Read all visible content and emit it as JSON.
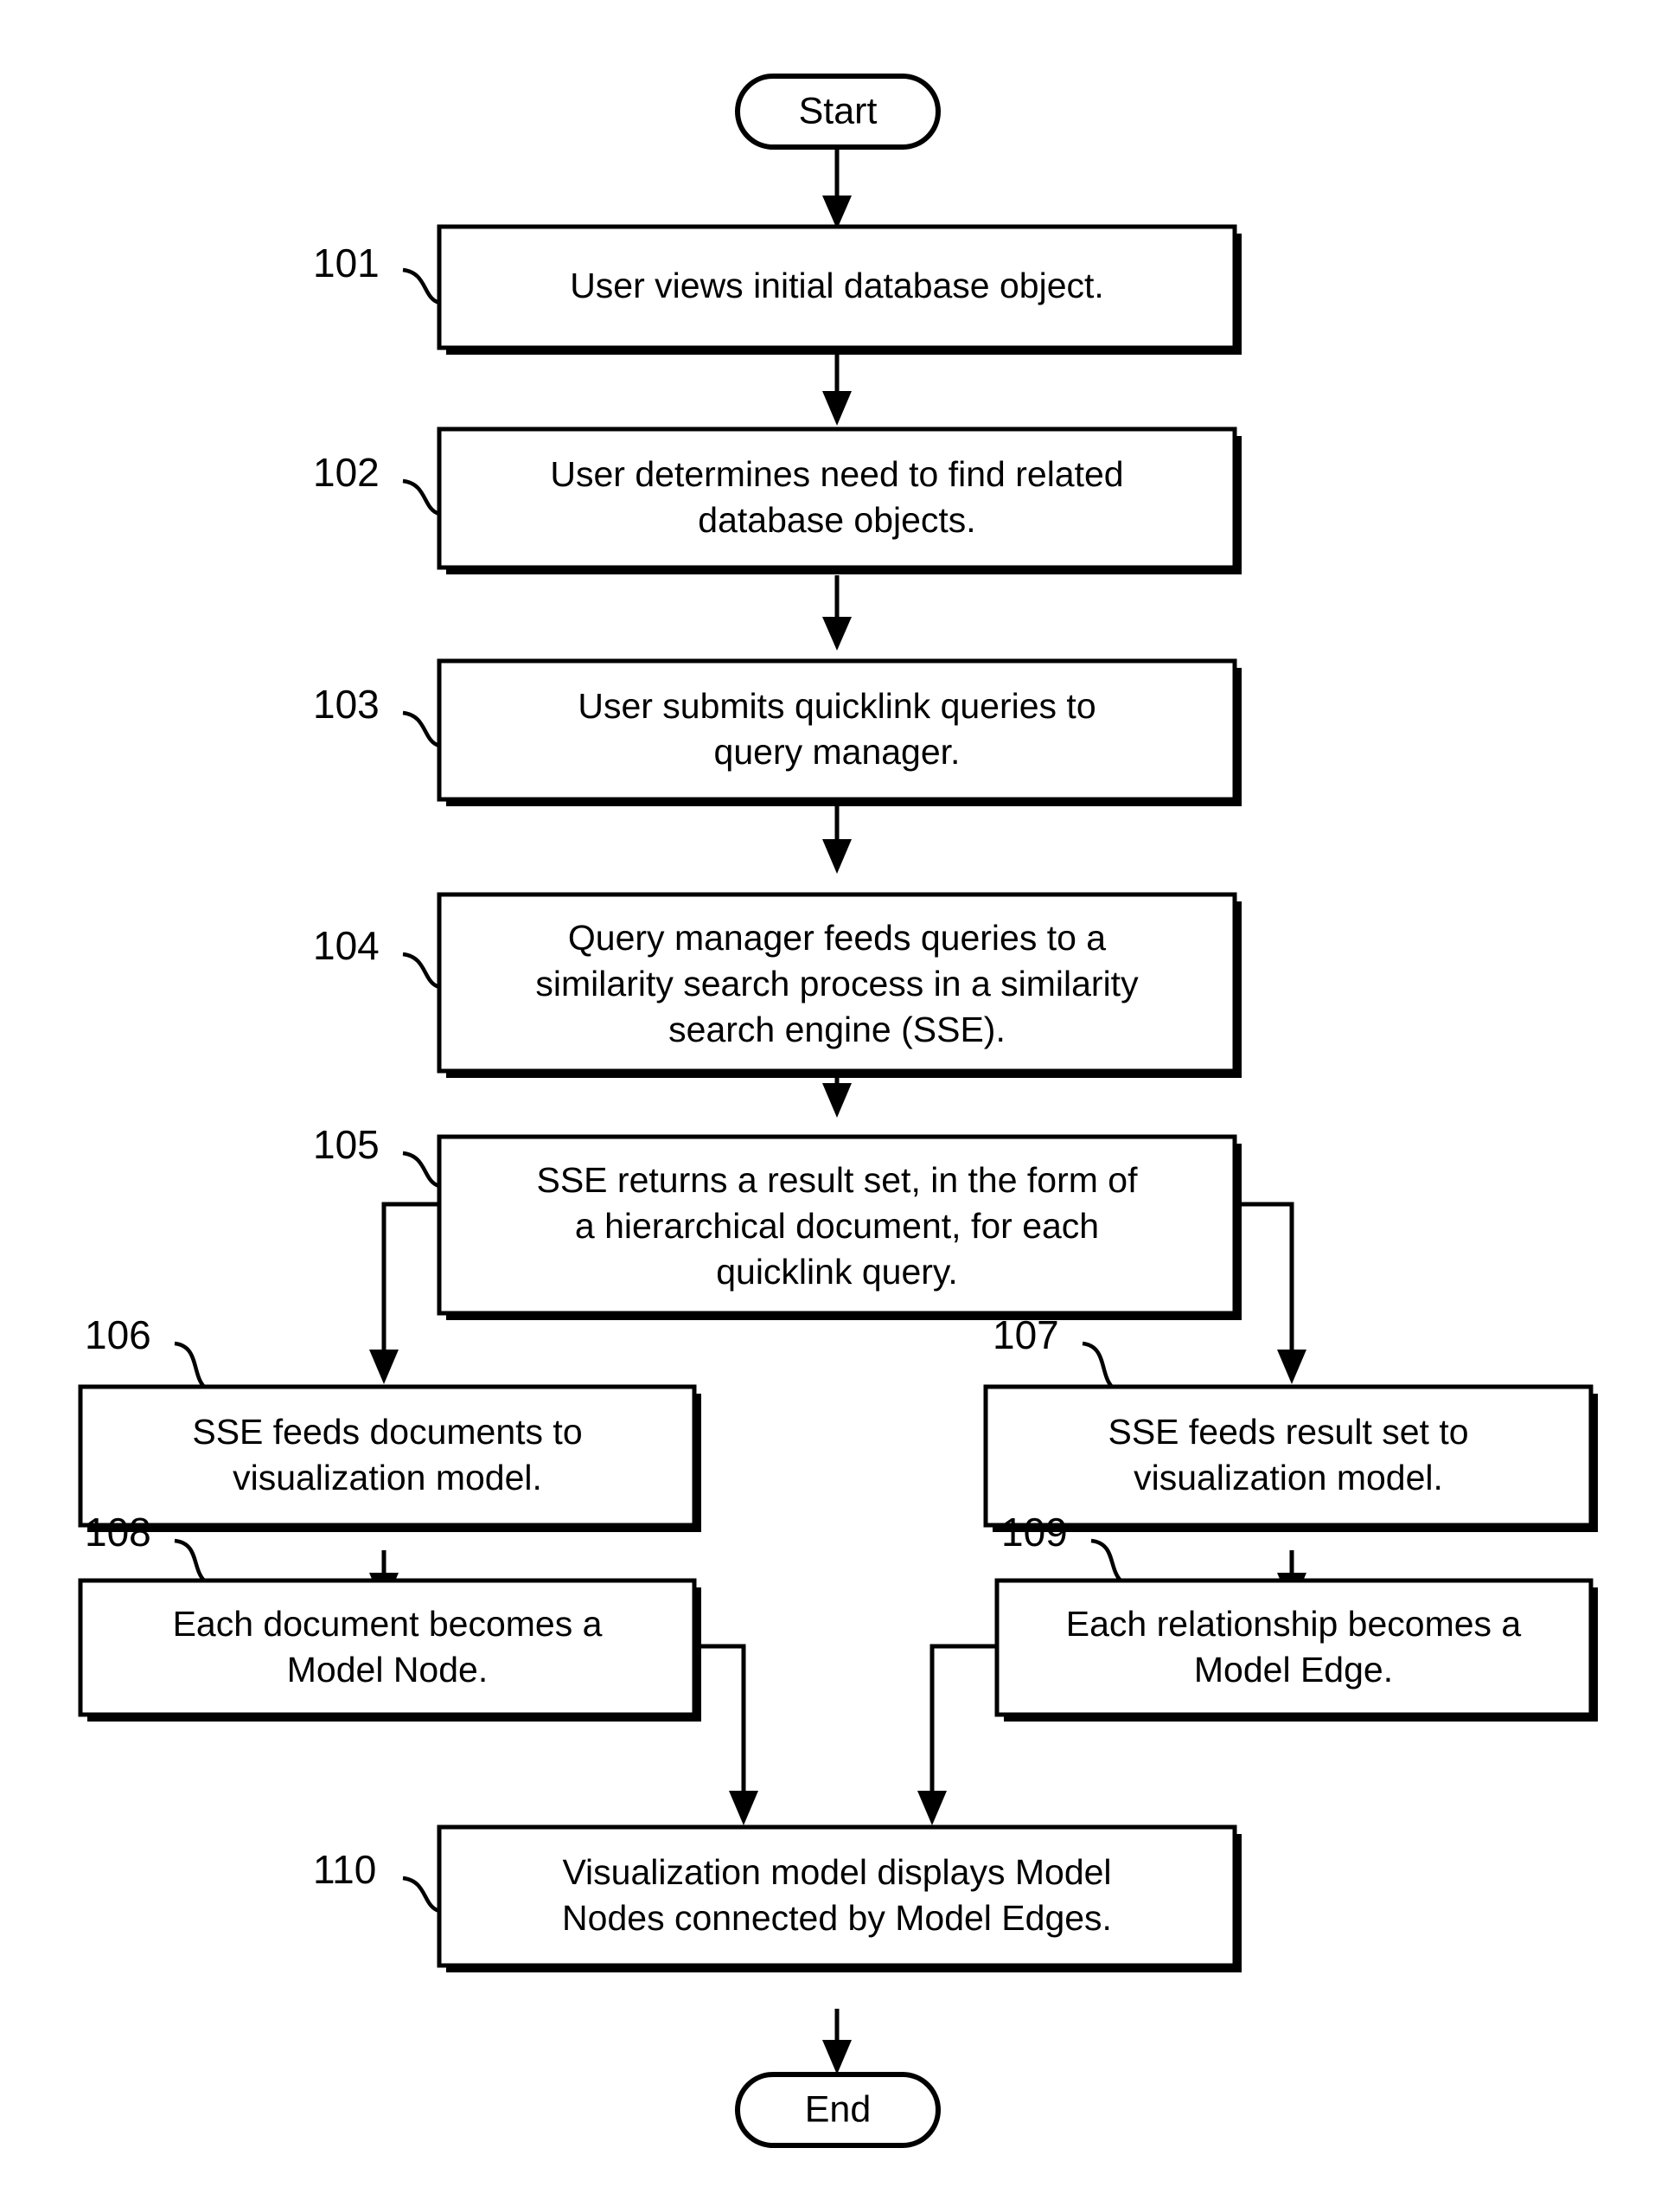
{
  "diagram": {
    "type": "flowchart",
    "orientation": "top-to-bottom",
    "terminators": {
      "start": "Start",
      "end": "End"
    },
    "steps": [
      {
        "ref": "101",
        "lines": [
          "User views initial database object."
        ]
      },
      {
        "ref": "102",
        "lines": [
          "User determines need to find related",
          "database objects."
        ]
      },
      {
        "ref": "103",
        "lines": [
          "User submits quicklink queries to",
          "query manager."
        ]
      },
      {
        "ref": "104",
        "lines": [
          "Query manager feeds queries to a",
          "similarity search process in a similarity",
          "search engine (SSE)."
        ]
      },
      {
        "ref": "105",
        "lines": [
          "SSE returns a result set, in the form of",
          "a hierarchical document, for each",
          "quicklink query."
        ]
      },
      {
        "ref": "106",
        "lines": [
          "SSE feeds documents to",
          "visualization model."
        ]
      },
      {
        "ref": "107",
        "lines": [
          "SSE feeds result set to",
          "visualization model."
        ]
      },
      {
        "ref": "108",
        "lines": [
          "Each document becomes a",
          "Model Node."
        ]
      },
      {
        "ref": "109",
        "lines": [
          "Each relationship becomes a",
          "Model Edge."
        ]
      },
      {
        "ref": "110",
        "lines": [
          "Visualization model displays Model",
          "Nodes connected by Model Edges."
        ]
      }
    ],
    "colors": {
      "stroke": "#000000",
      "fill": "#ffffff",
      "background": "#ffffff"
    }
  }
}
